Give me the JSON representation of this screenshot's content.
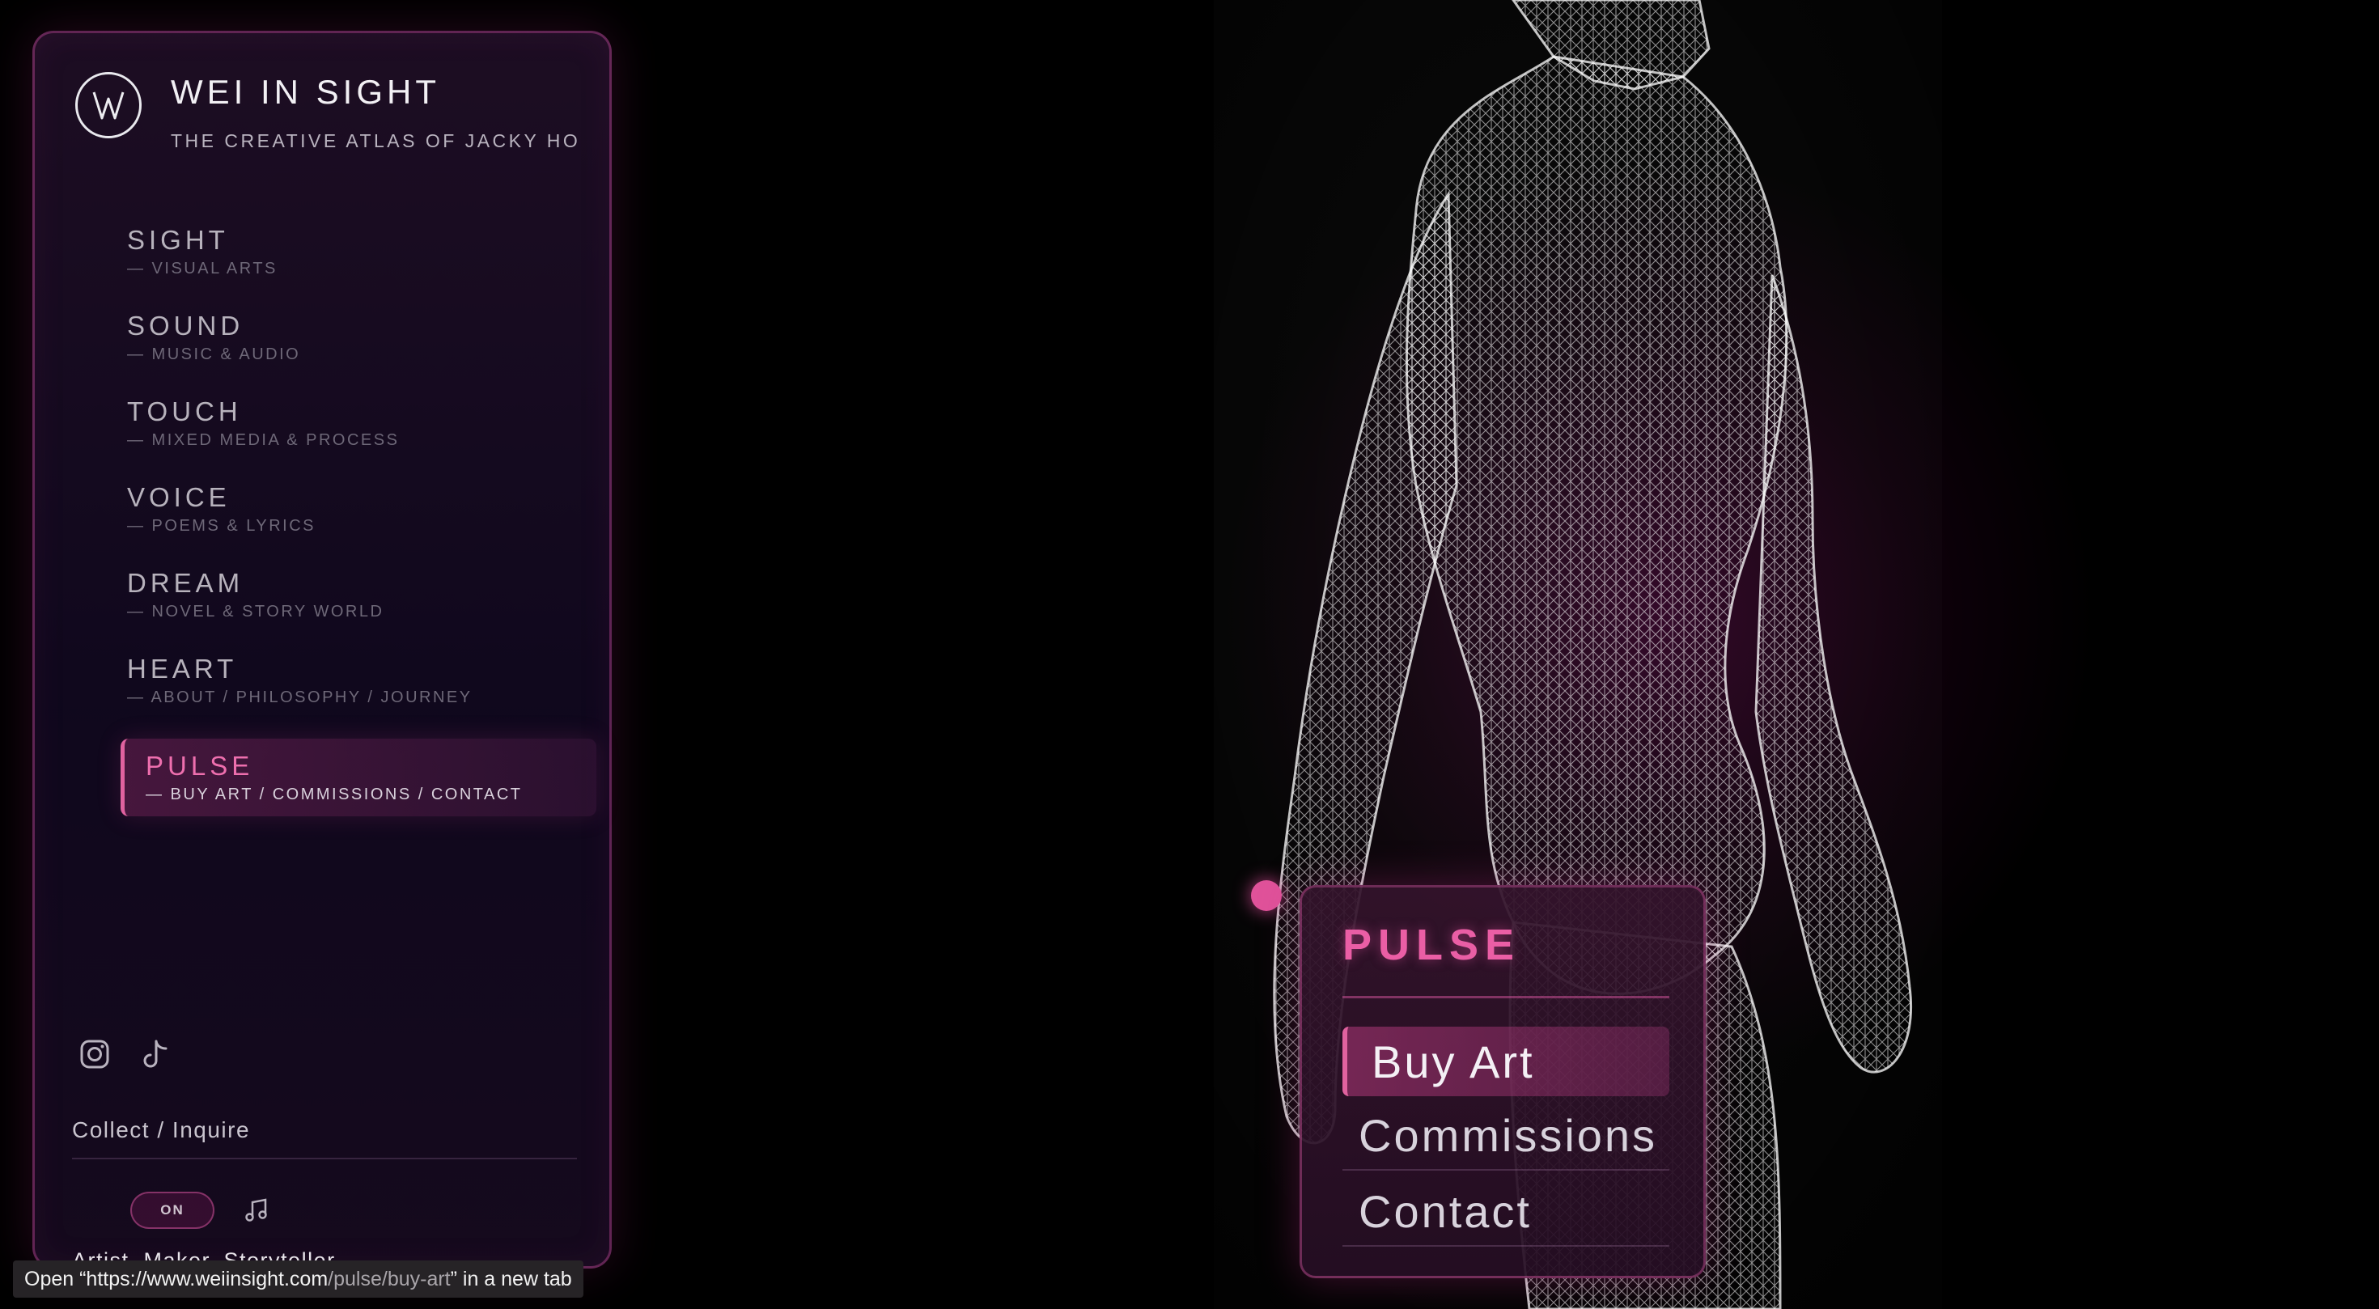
{
  "brand": {
    "title": "WEI IN SIGHT",
    "subtitle": "THE CREATIVE ATLAS OF JACKY HO",
    "logo_icon": "w-monogram-logo"
  },
  "nav": [
    {
      "title": "SIGHT",
      "sub": "— VISUAL ARTS",
      "active": false
    },
    {
      "title": "SOUND",
      "sub": "— MUSIC & AUDIO",
      "active": false
    },
    {
      "title": "TOUCH",
      "sub": "— MIXED MEDIA & PROCESS",
      "active": false
    },
    {
      "title": "VOICE",
      "sub": "— POEMS & LYRICS",
      "active": false
    },
    {
      "title": "DREAM",
      "sub": "— NOVEL & STORY WORLD",
      "active": false
    },
    {
      "title": "HEART",
      "sub": "— ABOUT / PHILOSOPHY / JOURNEY",
      "active": false
    },
    {
      "title": "PULSE",
      "sub": "— BUY ART / COMMISSIONS / CONTACT",
      "active": true
    }
  ],
  "socials": {
    "icons": [
      "instagram-icon",
      "tiktok-icon"
    ]
  },
  "collect_label": "Collect / Inquire",
  "sound": {
    "toggle_label": "ON",
    "icon": "music-note-icon"
  },
  "tagline": "Artist. Maker. Storyteller.",
  "popup": {
    "title": "PULSE",
    "items": [
      "Buy Art",
      "Commissions",
      "Contact"
    ],
    "selected": "Buy Art"
  },
  "statusbar": {
    "prefix": "Open “https://www.weiinsight.com",
    "path": "/pulse/buy-art",
    "suffix": "” in a new tab"
  },
  "colors": {
    "accent": "#e0629f",
    "background": "#000000",
    "panel": "#1a0c22"
  }
}
